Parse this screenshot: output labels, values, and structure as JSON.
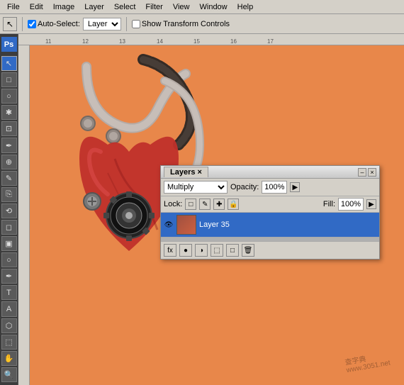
{
  "menubar": {
    "items": [
      "File",
      "Edit",
      "Image",
      "Layer",
      "Select",
      "Filter",
      "View",
      "Window",
      "Help"
    ]
  },
  "toolbar": {
    "auto_select_label": "Auto-Select:",
    "layer_option": "Layer",
    "show_transform": "Show Transform Controls",
    "move_tool_symbol": "↖"
  },
  "ps_logo": "Ps",
  "tools": [
    "↖",
    "□",
    "○",
    "✂",
    "✒",
    "S",
    "⚕",
    "✎",
    "T",
    "A",
    "⬡",
    "✋",
    "🔍",
    "⬚"
  ],
  "layers_panel": {
    "title": "Layers",
    "close_symbol": "×",
    "minimize_symbol": "–",
    "blend_mode": "Multiply",
    "opacity_label": "Opacity:",
    "opacity_value": "100%",
    "lock_label": "Lock:",
    "fill_label": "Fill:",
    "fill_value": "100%",
    "lock_icons": [
      "□",
      "✎",
      "✚",
      "🔒"
    ],
    "layers": [
      {
        "name": "Layer 35",
        "visible": true,
        "selected": false
      }
    ],
    "bottom_icons": [
      "fx",
      "●",
      "□",
      "⬚",
      "🗑"
    ]
  },
  "canvas": {
    "ruler_numbers_top": [
      "11",
      "12",
      "13",
      "14",
      "15",
      "16",
      "17"
    ],
    "background_color": "#e8874a"
  },
  "watermark": {
    "line1": "查字典",
    "line2": "www.3051.net"
  }
}
